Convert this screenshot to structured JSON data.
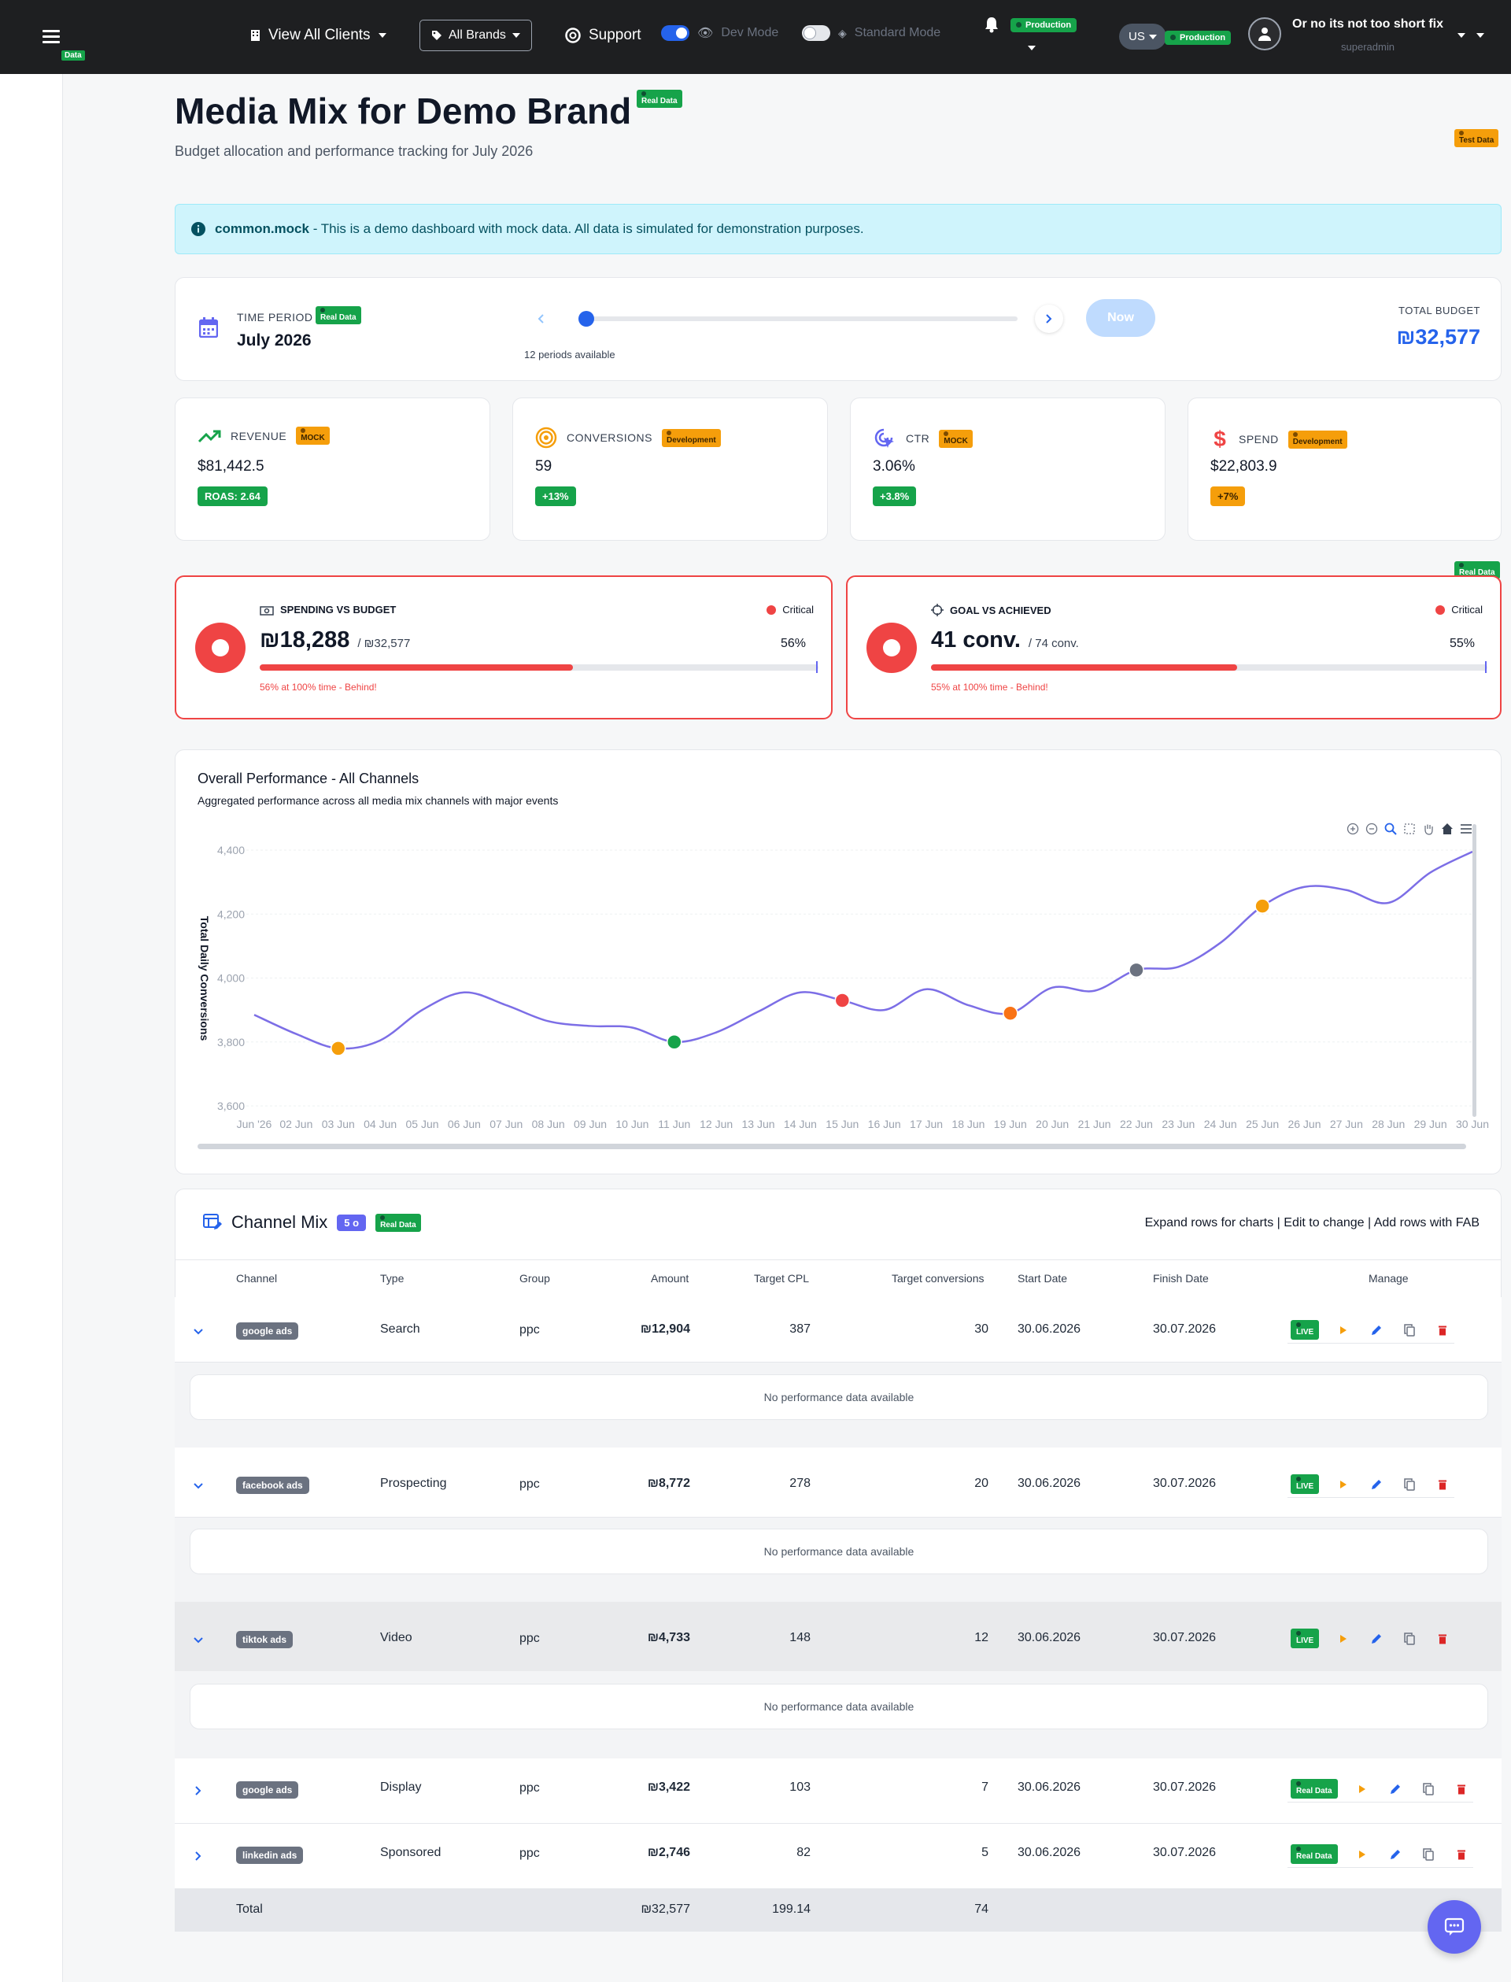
{
  "navbar": {
    "env_tag": "Data",
    "clients_label": "View All Clients",
    "brands_label": "All Brands",
    "support_label": "Support",
    "dev_mode_label": "Dev Mode",
    "standard_mode_label": "Standard Mode",
    "notification_env": "Production",
    "region": "US",
    "region_env": "Production",
    "user_name": "Or no its not too short fix",
    "user_role": "superadmin"
  },
  "header": {
    "title": "Media Mix for Demo Brand",
    "title_tag": "Real Data",
    "subtitle": "Budget allocation and performance tracking for July 2026",
    "test_tag": "Test Data"
  },
  "alert": {
    "key": "common.mock",
    "text": " - This is a demo dashboard with mock data. All data is simulated for demonstration purposes."
  },
  "period": {
    "label": "TIME PERIOD",
    "tag": "Real Data",
    "value": "July 2026",
    "available": "12 periods available",
    "now_label": "Now",
    "total_budget_label": "TOTAL BUDGET",
    "total_budget": "₪32,577"
  },
  "kpis": [
    {
      "label": "REVENUE",
      "tag": "MOCK",
      "value": "$81,442.5",
      "badge": "ROAS: 2.64"
    },
    {
      "label": "CONVERSIONS",
      "tag": "Development",
      "value": "59",
      "badge": "+13%"
    },
    {
      "label": "CTR",
      "tag": "MOCK",
      "value": "3.06%",
      "badge": "+3.8%"
    },
    {
      "label": "SPEND",
      "tag": "Development",
      "value": "$22,803.9",
      "badge": "+7%"
    }
  ],
  "status_cards": {
    "corner_tag": "Real Data",
    "spending": {
      "title": "SPENDING VS BUDGET",
      "status": "Critical",
      "value": "₪18,288",
      "of": "/ ₪32,577",
      "percent_label": "56%",
      "progress": 0.56,
      "note": "56% at 100% time - Behind!"
    },
    "goal": {
      "title": "GOAL VS ACHIEVED",
      "status": "Critical",
      "value": "41 conv.",
      "of": "/ 74 conv.",
      "percent_label": "55%",
      "progress": 0.55,
      "note": "55% at 100% time - Behind!"
    }
  },
  "chart_data": {
    "type": "line",
    "title": "Overall Performance - All Channels",
    "subtitle": "Aggregated performance across all media mix channels with major events",
    "ylabel": "Total Daily Conversions",
    "ylim": [
      3600,
      4400
    ],
    "yticks": [
      "4,400",
      "4,200",
      "4,000",
      "3,800",
      "3,600"
    ],
    "categories": [
      "Jun '26",
      "02 Jun",
      "03 Jun",
      "04 Jun",
      "05 Jun",
      "06 Jun",
      "07 Jun",
      "08 Jun",
      "09 Jun",
      "10 Jun",
      "11 Jun",
      "12 Jun",
      "13 Jun",
      "14 Jun",
      "15 Jun",
      "16 Jun",
      "17 Jun",
      "18 Jun",
      "19 Jun",
      "20 Jun",
      "21 Jun",
      "22 Jun",
      "23 Jun",
      "24 Jun",
      "25 Jun",
      "26 Jun",
      "27 Jun",
      "28 Jun",
      "29 Jun",
      "30 Jun"
    ],
    "values": [
      3885,
      3825,
      3780,
      3805,
      3900,
      3955,
      3915,
      3865,
      3850,
      3845,
      3800,
      3830,
      3895,
      3955,
      3930,
      3900,
      3965,
      3915,
      3890,
      3970,
      3960,
      4025,
      4035,
      4110,
      4225,
      4285,
      4275,
      4235,
      4330,
      4395
    ],
    "events": [
      {
        "index": 2,
        "color": "#f59e0b"
      },
      {
        "index": 10,
        "color": "#16a34a"
      },
      {
        "index": 14,
        "color": "#ef4444"
      },
      {
        "index": 18,
        "color": "#f97316"
      },
      {
        "index": 21,
        "color": "#6b7280"
      },
      {
        "index": 24,
        "color": "#f59e0b"
      }
    ],
    "line_color": "#7c6ee6"
  },
  "channel_mix": {
    "title": "Channel Mix",
    "count_badge": "5 o",
    "tag": "Real Data",
    "hint": "Expand rows for charts | Edit to change | Add rows with FAB",
    "columns": [
      "Channel",
      "Type",
      "Group",
      "Amount",
      "Target CPL",
      "Target conversions",
      "Start Date",
      "Finish Date",
      "Manage"
    ],
    "no_data": "No performance data available",
    "rows": [
      {
        "channel": "google ads",
        "type": "Search",
        "group": "ppc",
        "amount": "₪12,904",
        "cpl": "387",
        "conv": "30",
        "start": "30.06.2026",
        "finish": "30.07.2026",
        "status": "LIVE"
      },
      {
        "channel": "facebook ads",
        "type": "Prospecting",
        "group": "ppc",
        "amount": "₪8,772",
        "cpl": "278",
        "conv": "20",
        "start": "30.06.2026",
        "finish": "30.07.2026",
        "status": "LIVE"
      },
      {
        "channel": "tiktok ads",
        "type": "Video",
        "group": "ppc",
        "amount": "₪4,733",
        "cpl": "148",
        "conv": "12",
        "start": "30.06.2026",
        "finish": "30.07.2026",
        "status": "LIVE"
      },
      {
        "channel": "google ads",
        "type": "Display",
        "group": "ppc",
        "amount": "₪3,422",
        "cpl": "103",
        "conv": "7",
        "start": "30.06.2026",
        "finish": "30.07.2026",
        "status": "Real Data"
      },
      {
        "channel": "linkedin ads",
        "type": "Sponsored",
        "group": "ppc",
        "amount": "₪2,746",
        "cpl": "82",
        "conv": "5",
        "start": "30.06.2026",
        "finish": "30.07.2026",
        "status": "Real Data"
      }
    ],
    "total": {
      "label": "Total",
      "amount": "₪32,577",
      "cpl": "199.14",
      "conv": "74"
    }
  }
}
